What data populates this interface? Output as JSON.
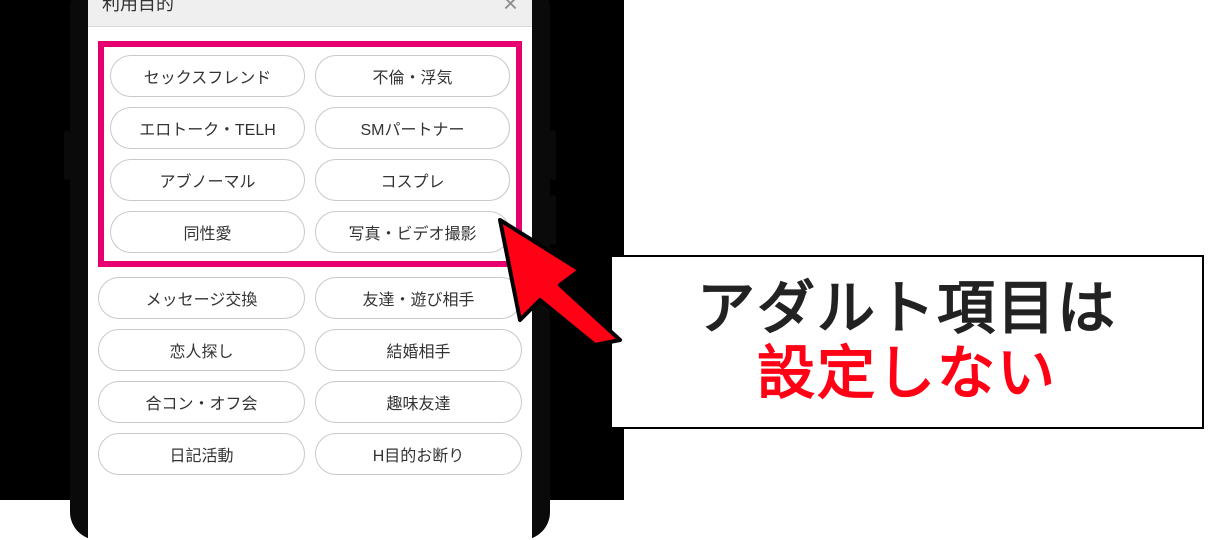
{
  "modal": {
    "title": "利用目的",
    "close_glyph": "×",
    "adult_chips": [
      [
        "セックスフレンド",
        "不倫・浮気"
      ],
      [
        "エロトーク・TELH",
        "SMパートナー"
      ],
      [
        "アブノーマル",
        "コスプレ"
      ],
      [
        "同性愛",
        "写真・ビデオ撮影"
      ]
    ],
    "normal_chips": [
      [
        "メッセージ交換",
        "友達・遊び相手"
      ],
      [
        "恋人探し",
        "結婚相手"
      ],
      [
        "合コン・オフ会",
        "趣味友達"
      ],
      [
        "日記活動",
        "H目的お断り"
      ]
    ]
  },
  "callout": {
    "line1": "アダルト項目は",
    "line2": "設定しない"
  },
  "colors": {
    "highlight": "#e6006f",
    "arrow": "#ff0015",
    "warn_text": "#ff0015"
  }
}
